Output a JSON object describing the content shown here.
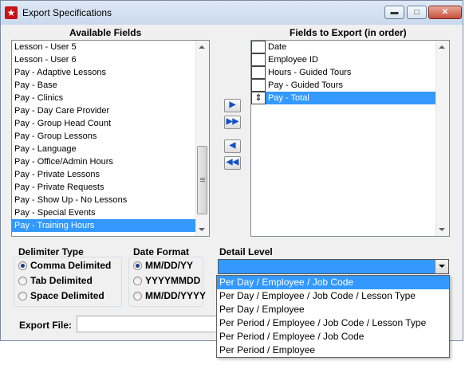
{
  "window": {
    "title": "Export Specifications",
    "minimize": "▬",
    "maximize": "□",
    "close": "✕"
  },
  "available": {
    "header": "Available Fields",
    "items": [
      {
        "label": "Lesson - User 5",
        "selected": false
      },
      {
        "label": "Lesson - User 6",
        "selected": false
      },
      {
        "label": "Pay - Adaptive Lessons",
        "selected": false
      },
      {
        "label": "Pay - Base",
        "selected": false
      },
      {
        "label": "Pay - Clinics",
        "selected": false
      },
      {
        "label": "Pay - Day Care Provider",
        "selected": false
      },
      {
        "label": "Pay - Group Head Count",
        "selected": false
      },
      {
        "label": "Pay - Group Lessons",
        "selected": false
      },
      {
        "label": "Pay - Language",
        "selected": false
      },
      {
        "label": "Pay - Office/Admin Hours",
        "selected": false
      },
      {
        "label": "Pay - Private Lessons",
        "selected": false
      },
      {
        "label": "Pay - Private Requests",
        "selected": false
      },
      {
        "label": "Pay - Show Up - No Lessons",
        "selected": false
      },
      {
        "label": "Pay - Special Events",
        "selected": false
      },
      {
        "label": "Pay - Training Hours",
        "selected": true
      }
    ]
  },
  "export": {
    "header": "Fields to Export (in order)",
    "items": [
      {
        "label": "Date",
        "selected": false,
        "marker": ""
      },
      {
        "label": "Employee ID",
        "selected": false,
        "marker": ""
      },
      {
        "label": "Hours - Guided Tours",
        "selected": false,
        "marker": ""
      },
      {
        "label": "Pay - Guided Tours",
        "selected": false,
        "marker": ""
      },
      {
        "label": "Pay - Total",
        "selected": true,
        "marker": "⇕"
      }
    ]
  },
  "move_buttons": {
    "add": "▶",
    "add_all": "▶▶",
    "remove": "◀",
    "remove_all": "◀◀"
  },
  "delimiter": {
    "label": "Delimiter Type",
    "options": [
      {
        "label": "Comma Delimited",
        "checked": true
      },
      {
        "label": "Tab Delimited",
        "checked": false
      },
      {
        "label": "Space Delimited",
        "checked": false
      }
    ]
  },
  "date_format": {
    "label": "Date Format",
    "options": [
      {
        "label": "MM/DD/YY",
        "checked": true
      },
      {
        "label": "YYYYMMDD",
        "checked": false
      },
      {
        "label": "MM/DD/YYYY",
        "checked": false
      }
    ]
  },
  "detail_level": {
    "label": "Detail Level",
    "value": "",
    "options": [
      {
        "label": "Per Day / Employee / Job Code",
        "selected": true
      },
      {
        "label": "Per Day / Employee / Job Code / Lesson Type",
        "selected": false
      },
      {
        "label": "Per Day / Employee",
        "selected": false
      },
      {
        "label": "Per Period / Employee / Job Code / Lesson Type",
        "selected": false
      },
      {
        "label": "Per Period / Employee / Job Code",
        "selected": false
      },
      {
        "label": "Per Period / Employee",
        "selected": false
      }
    ]
  },
  "export_file": {
    "label": "Export File:",
    "value": ""
  },
  "colors": {
    "selection": "#3399ff",
    "window_bg": "#f0f0f0",
    "close_red": "#c7503a"
  },
  "icons": {
    "app": "export-app-icon",
    "scroll_up": "arrow-up-icon",
    "scroll_down": "arrow-down-icon",
    "drag": "drag-handle-icon"
  }
}
